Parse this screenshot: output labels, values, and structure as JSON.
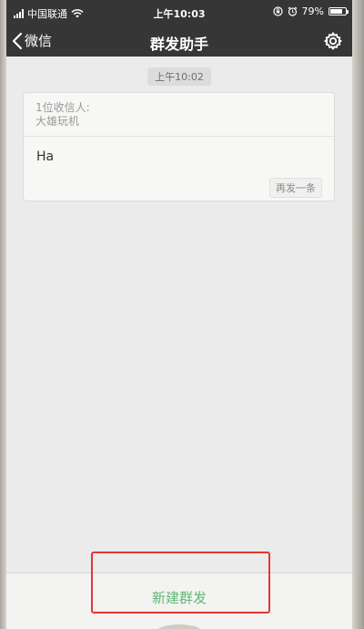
{
  "status_bar": {
    "carrier": "中国联通",
    "time": "上午10:03",
    "battery_percent": "79%",
    "battery_level": 0.79
  },
  "nav": {
    "back_label": "微信",
    "title": "群发助手",
    "icons": {
      "back": "chevron-left-icon",
      "settings": "gear-icon"
    }
  },
  "message": {
    "timestamp": "上午10:02",
    "recipients_label": "1位收信人:",
    "recipients": "大雄玩机",
    "text": "Ha",
    "resend_label": "再发一条"
  },
  "bottom": {
    "new_broadcast_label": "新建群发"
  },
  "colors": {
    "nav_bg": "#363636",
    "accent_green": "#5fb878",
    "highlight_red": "#e53535"
  }
}
